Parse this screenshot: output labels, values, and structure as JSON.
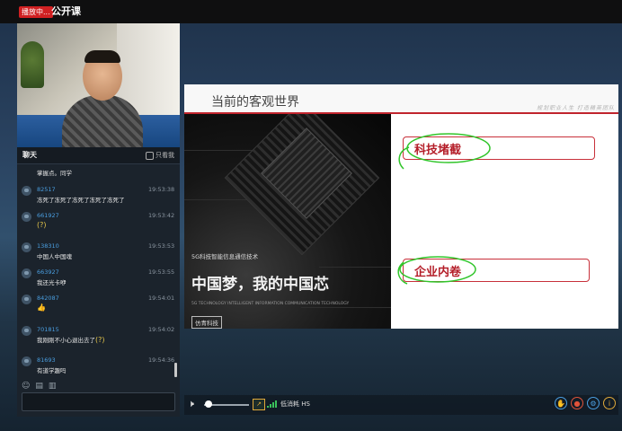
{
  "header": {
    "live_badge": "播放中...",
    "title": "公开课"
  },
  "chat": {
    "title": "聊天",
    "only_teacher": "只看我",
    "messages": [
      {
        "user": "",
        "time": "",
        "text": "掌握点。同学"
      },
      {
        "user": "82517",
        "time": "19:53:38",
        "text": "冻死了冻死了冻死了冻死了冻死了"
      },
      {
        "user": "661927",
        "time": "19:53:42",
        "text": "",
        "emoji": "(?)"
      },
      {
        "user": "138310",
        "time": "19:53:53",
        "text": "中国人中国魂"
      },
      {
        "user": "663927",
        "time": "19:53:55",
        "text": "我还光卡咿"
      },
      {
        "user": "842087",
        "time": "19:54:01",
        "text": "",
        "emoji": "👍"
      },
      {
        "user": "701815",
        "time": "19:54:02",
        "text": "我刚刚不小心退出去了",
        "emoji": "(?)"
      },
      {
        "user": "81693",
        "time": "19:54:36",
        "text": "有道学趣吗"
      }
    ],
    "tool_icons": [
      "smile-icon",
      "image-icon",
      "file-icon"
    ]
  },
  "slide": {
    "title": "当前的客观世界",
    "slogan": "规划职业人生  打造精英团队",
    "tag_5g": "5G科技智能信息通信技术",
    "headline": "中国梦，我的中国芯",
    "sub_en": "5G TECHNOLOGY INTELLIGENT INFORMATION COMMUNICATION TECHNOLOGY",
    "brand": "仿青科技",
    "callouts": [
      "科技堵截",
      "企业内卷"
    ]
  },
  "controls": {
    "latency_label": "低消耗 HS",
    "volume_level": 0.1,
    "icons": [
      "volume-icon",
      "camera-toggle-icon",
      "signal-icon",
      "hand-icon",
      "record-icon",
      "settings-icon",
      "info-icon"
    ]
  },
  "colors": {
    "accent_red": "#c0242d",
    "link_blue": "#4a9ee0",
    "signal_green": "#3ac25b",
    "callout_green": "#31c52a"
  }
}
